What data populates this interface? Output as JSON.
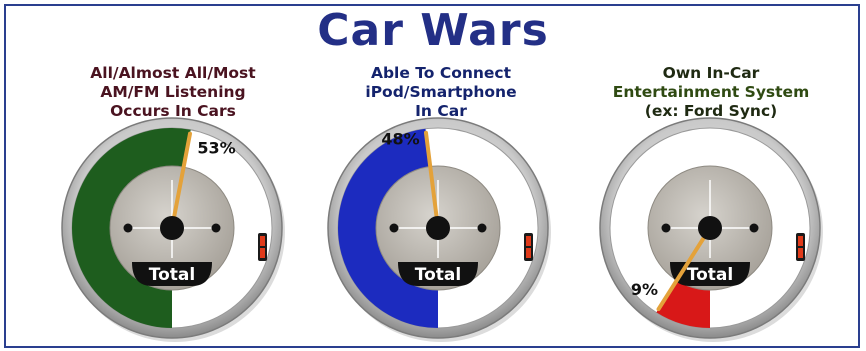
{
  "title": "Car Wars",
  "chart_data": [
    {
      "type": "gauge",
      "title_lines": [
        "All/Almost All/Most",
        "AM/FM Listening",
        "Occurs In Cars"
      ],
      "value": 53,
      "value_label": "53%",
      "dial_label": "Total",
      "fill_color": "#1e5d1e"
    },
    {
      "type": "gauge",
      "title_lines": [
        "Able To Connect",
        "iPod/Smartphone",
        "In Car"
      ],
      "value": 48,
      "value_label": "48%",
      "dial_label": "Total",
      "fill_color": "#1c2bbf"
    },
    {
      "type": "gauge",
      "title_lines": [
        "Own In-Car",
        "Entertainment System",
        "(ex: Ford Sync)"
      ],
      "value": 9,
      "value_label": "9%",
      "dial_label": "Total",
      "fill_color": "#d81818"
    }
  ]
}
